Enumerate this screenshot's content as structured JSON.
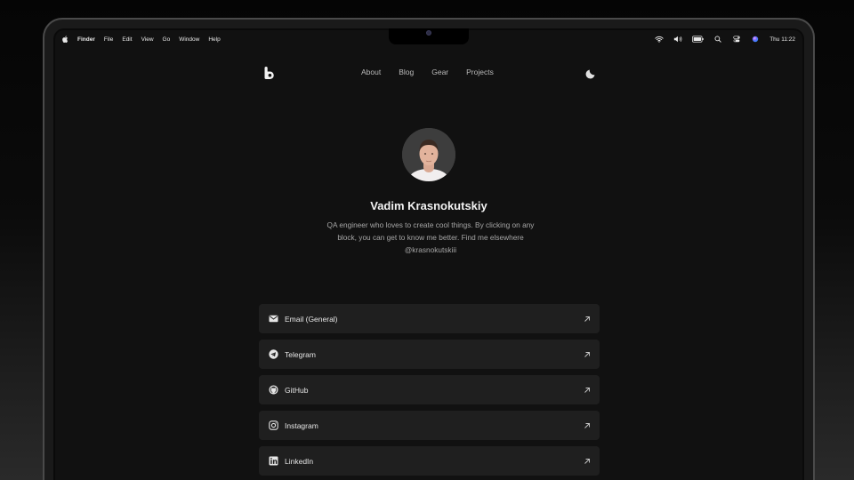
{
  "menubar": {
    "app": "Finder",
    "menus": [
      "File",
      "Edit",
      "View",
      "Go",
      "Window",
      "Help"
    ],
    "clock": "Thu 11:22"
  },
  "site": {
    "nav": [
      "About",
      "Blog",
      "Gear",
      "Projects"
    ]
  },
  "profile": {
    "name": "Vadim Krasnokutskiy",
    "bio": "QA engineer who loves to create cool things. By clicking on any block, you can get to know me better. Find me elsewhere @krasnokutskiii"
  },
  "links": [
    {
      "label": "Email (General)",
      "icon": "mail-icon"
    },
    {
      "label": "Telegram",
      "icon": "telegram-icon"
    },
    {
      "label": "GitHub",
      "icon": "github-icon"
    },
    {
      "label": "Instagram",
      "icon": "instagram-icon"
    },
    {
      "label": "LinkedIn",
      "icon": "linkedin-icon"
    }
  ]
}
